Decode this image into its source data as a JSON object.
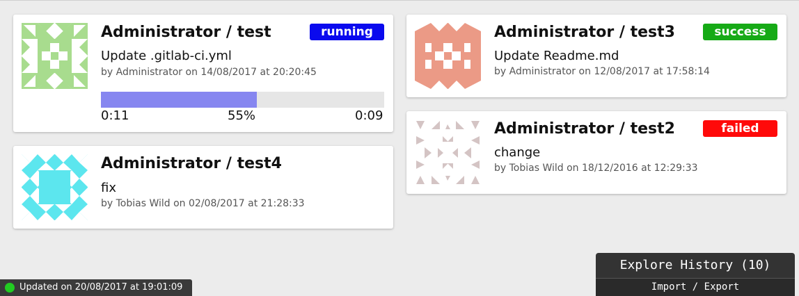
{
  "colors": {
    "running": "#0a0aee",
    "success": "#16aa16",
    "failed": "#ff0a0a",
    "progress": "#8686f0",
    "status_dot": "#22cc22"
  },
  "projects": [
    {
      "title": "Administrator / test",
      "status": "running",
      "message": "Update .gitlab-ci.yml",
      "meta": "by Administrator on 14/08/2017 at 20:20:45",
      "avatar_icon": "identicon-green-icon",
      "progress": {
        "percent": 55,
        "elapsed": "0:11",
        "percent_label": "55%",
        "remaining": "0:09"
      }
    },
    {
      "title": "Administrator / test4",
      "message": "fix",
      "meta": "by Tobias Wild on 02/08/2017 at 21:28:33",
      "avatar_icon": "identicon-cyan-icon"
    },
    {
      "title": "Administrator / test3",
      "status": "success",
      "message": "Update Readme.md",
      "meta": "by Administrator on 12/08/2017 at 17:58:14",
      "avatar_icon": "identicon-salmon-icon"
    },
    {
      "title": "Administrator / test2",
      "status": "failed",
      "message": "change",
      "meta": "by Tobias Wild on 18/12/2016 at 12:29:33",
      "avatar_icon": "identicon-mauve-icon"
    }
  ],
  "footer": {
    "updated": "Updated on 20/08/2017 at 19:01:09",
    "explore_history": "Explore History (10)",
    "import_export": "Import / Export"
  }
}
